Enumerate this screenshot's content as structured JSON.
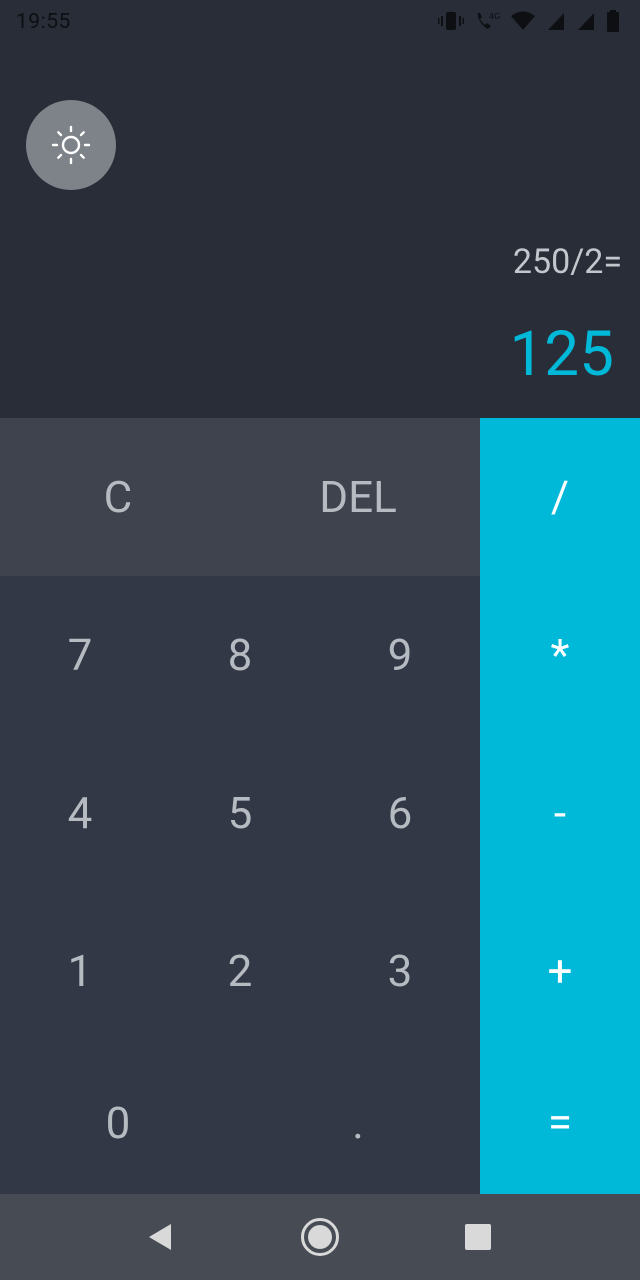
{
  "status_bar": {
    "time": "19:55"
  },
  "display": {
    "expression": "250/2=",
    "result": "125"
  },
  "keys": {
    "clear": "C",
    "delete": "DEL",
    "digits": [
      "7",
      "8",
      "9",
      "4",
      "5",
      "6",
      "1",
      "2",
      "3",
      "0",
      "."
    ],
    "operators": [
      "/",
      "*",
      "-",
      "+",
      "="
    ]
  },
  "colors": {
    "background": "#282d38",
    "keypad": "#323845",
    "top_row": "#3e434e",
    "accent": "#00b8d8",
    "key_text": "#b6bac1",
    "navbar": "#474c54"
  }
}
